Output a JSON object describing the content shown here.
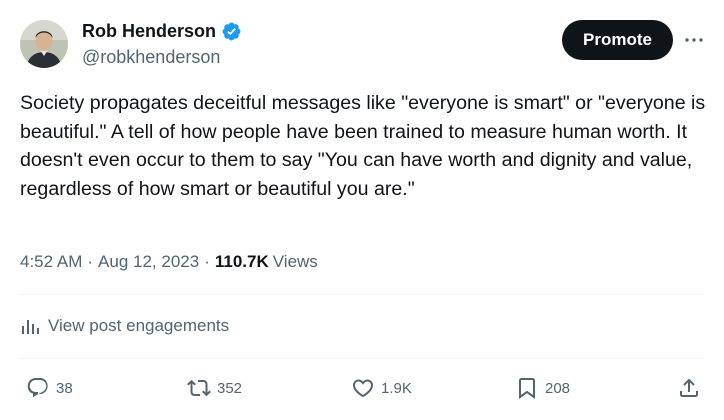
{
  "author": {
    "name": "Rob Henderson",
    "handle": "@robkhenderson",
    "verified": true
  },
  "header": {
    "promote_label": "Promote",
    "more_icon": "more-horizontal-icon"
  },
  "tweet": {
    "text": "Society propagates deceitful messages like \"everyone is smart\" or \"everyone is beautiful.\" A tell of how people have been trained to measure human worth. It doesn't even occur to them to say \"You can have worth and dignity and value, regardless of how smart or beautiful you are.\""
  },
  "meta": {
    "time": "4:52 AM",
    "separator": "·",
    "date": "Aug 12, 2023",
    "views_count": "110.7K",
    "views_label": "Views"
  },
  "engagements": {
    "label": "View post engagements",
    "icon": "bar-chart-icon"
  },
  "actions": {
    "reply_count": "38",
    "retweet_count": "352",
    "like_count": "1.9K",
    "bookmark_count": "208"
  },
  "colors": {
    "text_primary": "#0f1419",
    "text_secondary": "#536471",
    "verified_blue": "#1d9bf0",
    "promote_bg": "#0f1419",
    "divider": "#eff3f4"
  }
}
